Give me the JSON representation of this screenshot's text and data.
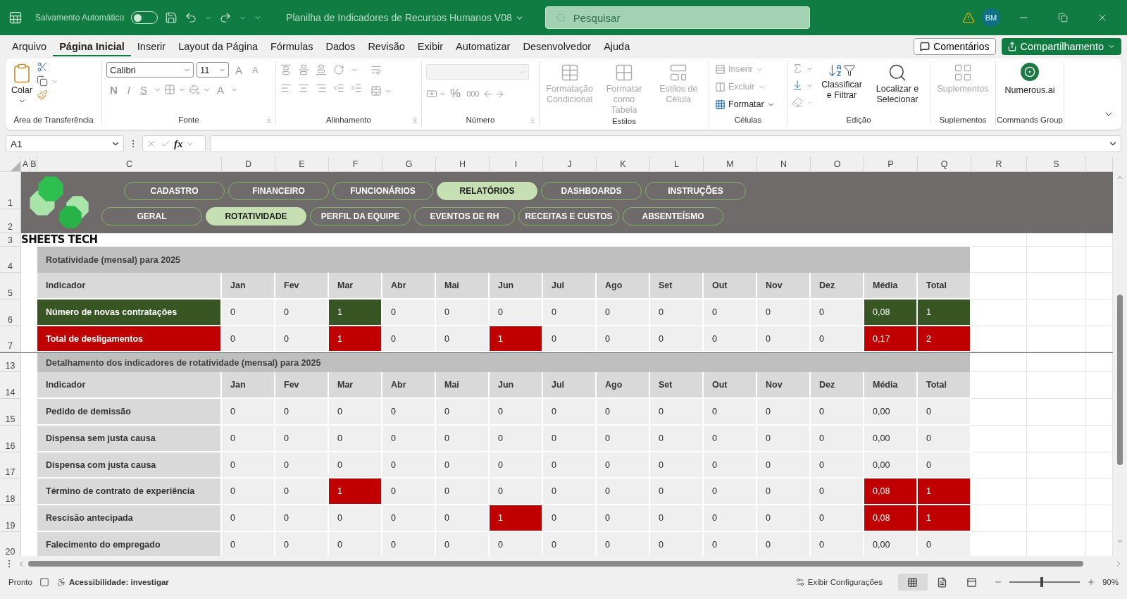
{
  "title_bar": {
    "autosave_label": "Salvamento Automático",
    "autosave_on": false,
    "document_title": "Planilha de Indicadores de Recursos Humanos V08",
    "search_placeholder": "Pesquisar",
    "avatar": "BM"
  },
  "menu_tabs": [
    {
      "label": "Arquivo",
      "selected": false
    },
    {
      "label": "Página Inicial",
      "selected": true
    },
    {
      "label": "Inserir",
      "selected": false
    },
    {
      "label": "Layout da Página",
      "selected": false
    },
    {
      "label": "Fórmulas",
      "selected": false
    },
    {
      "label": "Dados",
      "selected": false
    },
    {
      "label": "Revisão",
      "selected": false
    },
    {
      "label": "Exibir",
      "selected": false
    },
    {
      "label": "Automatizar",
      "selected": false
    },
    {
      "label": "Desenvolvedor",
      "selected": false
    },
    {
      "label": "Ajuda",
      "selected": false
    }
  ],
  "comments_button": "Comentários",
  "share_button": "Compartilhamento",
  "ribbon": {
    "clipboard": {
      "paste": "Colar",
      "label": "Área de Transferência"
    },
    "font": {
      "name": "Calibri",
      "size": "11",
      "grow": "A",
      "shrink": "A",
      "bold": "N",
      "italic": "I",
      "underline": "S",
      "color_letter": "A",
      "label": "Fonte"
    },
    "alignment": {
      "label": "Alinhamento"
    },
    "number": {
      "percent": "%",
      "thousands": "000",
      "label": "Número"
    },
    "styles": {
      "label": "Estilos",
      "items": [
        {
          "label": "Formatação Condicional",
          "disabled": true
        },
        {
          "label": "Formatar como Tabela",
          "disabled": true
        },
        {
          "label": "Estilos de Célula",
          "disabled": true
        }
      ]
    },
    "cells": {
      "label": "Células",
      "items": [
        {
          "label": "Inserir",
          "disabled": true
        },
        {
          "label": "Excluir",
          "disabled": true
        },
        {
          "label": "Formatar",
          "disabled": false
        }
      ]
    },
    "editing": {
      "sort": "Classificar e Filtrar",
      "find": "Localizar e Selecionar",
      "label": "Edição"
    },
    "addins": {
      "button": "Suplementos",
      "disabled": true,
      "label": "Suplementos"
    },
    "commands": {
      "button": "Numerous.ai",
      "label": "Commands Group"
    }
  },
  "formula_bar": {
    "name_box": "A1",
    "fx": "fx"
  },
  "columns": [
    "A",
    "B",
    "C",
    "D",
    "E",
    "F",
    "G",
    "H",
    "I",
    "J",
    "K",
    "L",
    "M",
    "N",
    "O",
    "P",
    "Q",
    "R",
    "S"
  ],
  "row_numbers": [
    "1",
    "2",
    "3",
    "4",
    "5",
    "6",
    "7",
    "13",
    "14",
    "15",
    "16",
    "17",
    "18",
    "19",
    "20"
  ],
  "banner": {
    "brand": "SHEETS TECH",
    "nav_top": [
      {
        "label": "CADASTRO",
        "selected": false
      },
      {
        "label": "FINANCEIRO",
        "selected": false
      },
      {
        "label": "FUNCIONÁRIOS",
        "selected": false
      },
      {
        "label": "RELATÓRIOS",
        "selected": true
      },
      {
        "label": "DASHBOARDS",
        "selected": false
      },
      {
        "label": "INSTRUÇÕES",
        "selected": false
      }
    ],
    "nav_bottom": [
      {
        "label": "GERAL",
        "selected": false
      },
      {
        "label": "ROTATIVIDADE",
        "selected": true
      },
      {
        "label": "PERFIL DA EQUIPE",
        "selected": false
      },
      {
        "label": "EVENTOS DE RH",
        "selected": false
      },
      {
        "label": "RECEITAS E CUSTOS",
        "selected": false
      },
      {
        "label": "ABSENTEÍSMO",
        "selected": false
      }
    ]
  },
  "tables": [
    {
      "title": "Rotatividade (mensal) para 2025",
      "header": [
        "Indicador",
        "Jan",
        "Fev",
        "Mar",
        "Abr",
        "Mai",
        "Jun",
        "Jul",
        "Ago",
        "Set",
        "Out",
        "Nov",
        "Dez",
        "Média",
        "Total"
      ],
      "rows": [
        {
          "indicator": "Número de novas contratações",
          "kind": "summary",
          "color": "#375623",
          "cells": [
            {
              "value": "0",
              "highlighted": false
            },
            {
              "value": "0",
              "highlighted": false
            },
            {
              "value": "1",
              "highlighted": true
            },
            {
              "value": "0",
              "highlighted": false
            },
            {
              "value": "0",
              "highlighted": false
            },
            {
              "value": "0",
              "highlighted": false
            },
            {
              "value": "0",
              "highlighted": false
            },
            {
              "value": "0",
              "highlighted": false
            },
            {
              "value": "0",
              "highlighted": false
            },
            {
              "value": "0",
              "highlighted": false
            },
            {
              "value": "0",
              "highlighted": false
            },
            {
              "value": "0",
              "highlighted": false
            },
            {
              "value": "0,08",
              "highlighted": true
            },
            {
              "value": "1",
              "highlighted": true
            }
          ]
        },
        {
          "indicator": "Total de desligamentos",
          "kind": "summary",
          "color": "#c00000",
          "cells": [
            {
              "value": "0",
              "highlighted": false
            },
            {
              "value": "0",
              "highlighted": false
            },
            {
              "value": "1",
              "highlighted": true
            },
            {
              "value": "0",
              "highlighted": false
            },
            {
              "value": "0",
              "highlighted": false
            },
            {
              "value": "1",
              "highlighted": true
            },
            {
              "value": "0",
              "highlighted": false
            },
            {
              "value": "0",
              "highlighted": false
            },
            {
              "value": "0",
              "highlighted": false
            },
            {
              "value": "0",
              "highlighted": false
            },
            {
              "value": "0",
              "highlighted": false
            },
            {
              "value": "0",
              "highlighted": false
            },
            {
              "value": "0,17",
              "highlighted": true
            },
            {
              "value": "2",
              "highlighted": true
            }
          ]
        }
      ]
    },
    {
      "title": "Detalhamento dos indicadores de rotatividade (mensal) para 2025",
      "color": "#c00000",
      "header": [
        "Indicador",
        "Jan",
        "Fev",
        "Mar",
        "Abr",
        "Mai",
        "Jun",
        "Jul",
        "Ago",
        "Set",
        "Out",
        "Nov",
        "Dez",
        "Média",
        "Total"
      ],
      "rows": [
        {
          "indicator": "Pedido de demissão",
          "kind": "detail",
          "cells": [
            {
              "value": "0",
              "highlighted": false
            },
            {
              "value": "0",
              "highlighted": false
            },
            {
              "value": "0",
              "highlighted": false
            },
            {
              "value": "0",
              "highlighted": false
            },
            {
              "value": "0",
              "highlighted": false
            },
            {
              "value": "0",
              "highlighted": false
            },
            {
              "value": "0",
              "highlighted": false
            },
            {
              "value": "0",
              "highlighted": false
            },
            {
              "value": "0",
              "highlighted": false
            },
            {
              "value": "0",
              "highlighted": false
            },
            {
              "value": "0",
              "highlighted": false
            },
            {
              "value": "0",
              "highlighted": false
            },
            {
              "value": "0,00",
              "highlighted": false
            },
            {
              "value": "0",
              "highlighted": false
            }
          ]
        },
        {
          "indicator": "Dispensa sem justa causa",
          "kind": "detail",
          "cells": [
            {
              "value": "0",
              "highlighted": false
            },
            {
              "value": "0",
              "highlighted": false
            },
            {
              "value": "0",
              "highlighted": false
            },
            {
              "value": "0",
              "highlighted": false
            },
            {
              "value": "0",
              "highlighted": false
            },
            {
              "value": "0",
              "highlighted": false
            },
            {
              "value": "0",
              "highlighted": false
            },
            {
              "value": "0",
              "highlighted": false
            },
            {
              "value": "0",
              "highlighted": false
            },
            {
              "value": "0",
              "highlighted": false
            },
            {
              "value": "0",
              "highlighted": false
            },
            {
              "value": "0",
              "highlighted": false
            },
            {
              "value": "0,00",
              "highlighted": false
            },
            {
              "value": "0",
              "highlighted": false
            }
          ]
        },
        {
          "indicator": "Dispensa com justa causa",
          "kind": "detail",
          "cells": [
            {
              "value": "0",
              "highlighted": false
            },
            {
              "value": "0",
              "highlighted": false
            },
            {
              "value": "0",
              "highlighted": false
            },
            {
              "value": "0",
              "highlighted": false
            },
            {
              "value": "0",
              "highlighted": false
            },
            {
              "value": "0",
              "highlighted": false
            },
            {
              "value": "0",
              "highlighted": false
            },
            {
              "value": "0",
              "highlighted": false
            },
            {
              "value": "0",
              "highlighted": false
            },
            {
              "value": "0",
              "highlighted": false
            },
            {
              "value": "0",
              "highlighted": false
            },
            {
              "value": "0",
              "highlighted": false
            },
            {
              "value": "0,00",
              "highlighted": false
            },
            {
              "value": "0",
              "highlighted": false
            }
          ]
        },
        {
          "indicator": "Término de contrato de experiência",
          "kind": "detail",
          "cells": [
            {
              "value": "0",
              "highlighted": false
            },
            {
              "value": "0",
              "highlighted": false
            },
            {
              "value": "1",
              "highlighted": true
            },
            {
              "value": "0",
              "highlighted": false
            },
            {
              "value": "0",
              "highlighted": false
            },
            {
              "value": "0",
              "highlighted": false
            },
            {
              "value": "0",
              "highlighted": false
            },
            {
              "value": "0",
              "highlighted": false
            },
            {
              "value": "0",
              "highlighted": false
            },
            {
              "value": "0",
              "highlighted": false
            },
            {
              "value": "0",
              "highlighted": false
            },
            {
              "value": "0",
              "highlighted": false
            },
            {
              "value": "0,08",
              "highlighted": true
            },
            {
              "value": "1",
              "highlighted": true
            }
          ]
        },
        {
          "indicator": "Rescisão antecipada",
          "kind": "detail",
          "cells": [
            {
              "value": "0",
              "highlighted": false
            },
            {
              "value": "0",
              "highlighted": false
            },
            {
              "value": "0",
              "highlighted": false
            },
            {
              "value": "0",
              "highlighted": false
            },
            {
              "value": "0",
              "highlighted": false
            },
            {
              "value": "1",
              "highlighted": true
            },
            {
              "value": "0",
              "highlighted": false
            },
            {
              "value": "0",
              "highlighted": false
            },
            {
              "value": "0",
              "highlighted": false
            },
            {
              "value": "0",
              "highlighted": false
            },
            {
              "value": "0",
              "highlighted": false
            },
            {
              "value": "0",
              "highlighted": false
            },
            {
              "value": "0,08",
              "highlighted": true
            },
            {
              "value": "1",
              "highlighted": true
            }
          ]
        },
        {
          "indicator": "Falecimento do empregado",
          "kind": "detail",
          "cells": [
            {
              "value": "0",
              "highlighted": false
            },
            {
              "value": "0",
              "highlighted": false
            },
            {
              "value": "0",
              "highlighted": false
            },
            {
              "value": "0",
              "highlighted": false
            },
            {
              "value": "0",
              "highlighted": false
            },
            {
              "value": "0",
              "highlighted": false
            },
            {
              "value": "0",
              "highlighted": false
            },
            {
              "value": "0",
              "highlighted": false
            },
            {
              "value": "0",
              "highlighted": false
            },
            {
              "value": "0",
              "highlighted": false
            },
            {
              "value": "0",
              "highlighted": false
            },
            {
              "value": "0",
              "highlighted": false
            },
            {
              "value": "0,00",
              "highlighted": false
            },
            {
              "value": "0",
              "highlighted": false
            }
          ]
        }
      ]
    }
  ],
  "status_bar": {
    "ready": "Pronto",
    "accessibility": "Acessibilidade: investigar",
    "display_settings": "Exibir Configurações",
    "views": [
      {
        "selected": true
      },
      {
        "selected": false
      },
      {
        "selected": false
      }
    ],
    "zoom_level": {
      "level": 0.46
    },
    "zoom": "90%"
  }
}
